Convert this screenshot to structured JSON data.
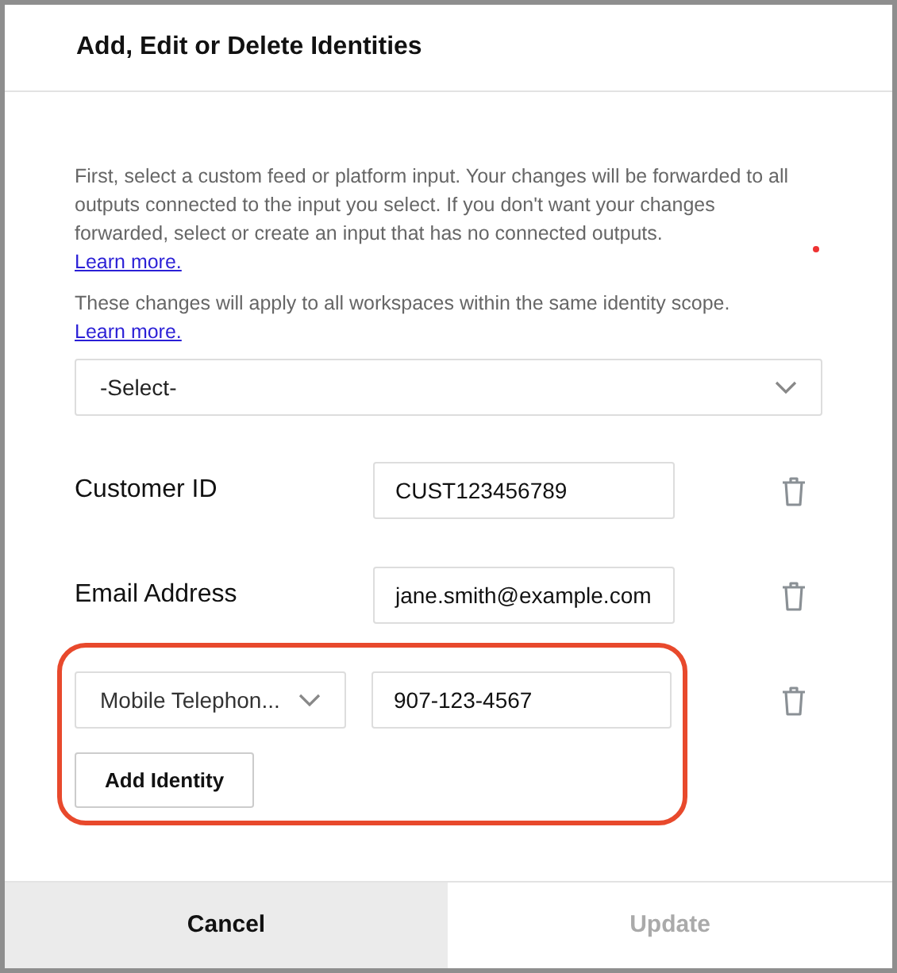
{
  "dialog": {
    "title": "Add, Edit or Delete Identities"
  },
  "notes": [
    {
      "text": "First, select a custom feed or platform input. Your changes will be forwarded to all outputs connected to the input you select. If you don't want your changes forwarded, select or create an input that has no connected outputs.",
      "link": "Learn more."
    },
    {
      "text": "These changes will apply to all workspaces within the same identity scope.",
      "link": "Learn more."
    }
  ],
  "input_select": {
    "value": "-Select-"
  },
  "identities": [
    {
      "kind": "fixed",
      "label": "Customer ID",
      "value": "CUST123456789"
    },
    {
      "kind": "fixed",
      "label": "Email Address",
      "value": "jane.smith@example.com"
    },
    {
      "kind": "choice",
      "label": "Mobile Telephon...",
      "value": "907-123-4567",
      "highlighted": true
    }
  ],
  "add_button": "Add Identity",
  "footer": {
    "cancel": "Cancel",
    "update": {
      "label": "Update",
      "disabled": true
    }
  }
}
